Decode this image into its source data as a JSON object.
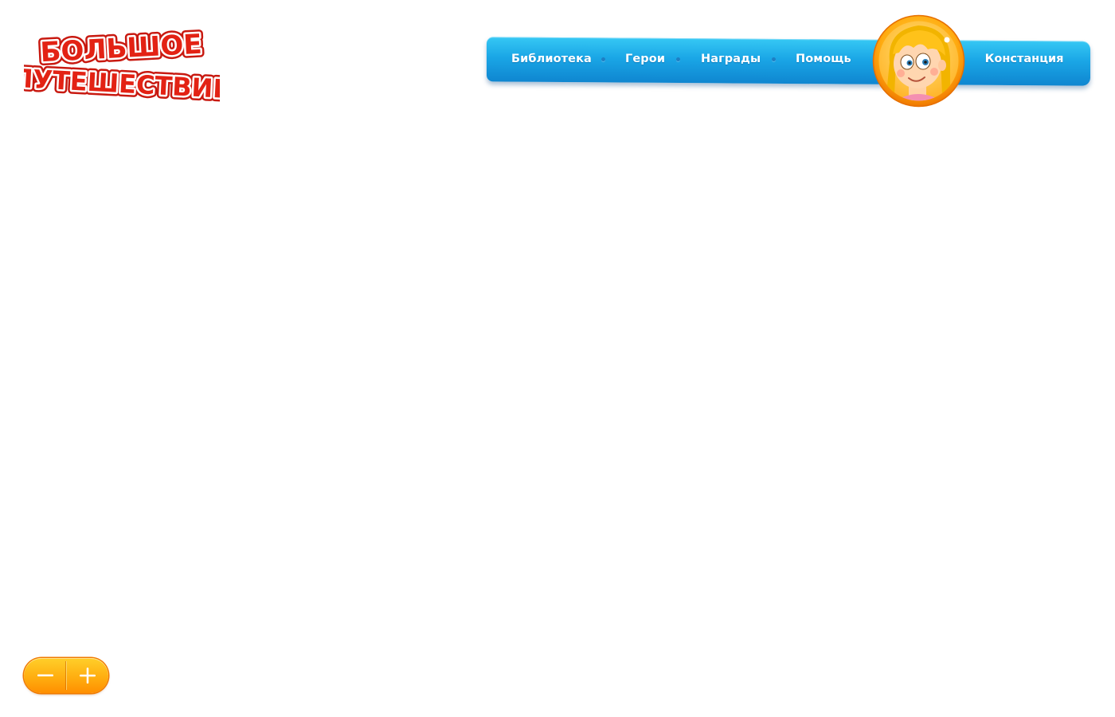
{
  "logo": {
    "line1": "БОЛЬШОЕ",
    "line2": "ПУТЕШЕСТВИЕ"
  },
  "nav": {
    "items": [
      {
        "label": "Библиотека"
      },
      {
        "label": "Герои"
      },
      {
        "label": "Награды"
      },
      {
        "label": "Помощь"
      }
    ],
    "username": "Констанция"
  },
  "avatar": {
    "icon": "girl-character-avatar-icon"
  },
  "zoom": {
    "out_icon": "minus-icon",
    "in_icon": "plus-icon"
  },
  "colors": {
    "nav_bar": "#1aa6e6",
    "nav_text": "#ffffff",
    "logo_red": "#e32214",
    "zoom_orange": "#ffae10",
    "avatar_ring": "#ff9a00"
  }
}
